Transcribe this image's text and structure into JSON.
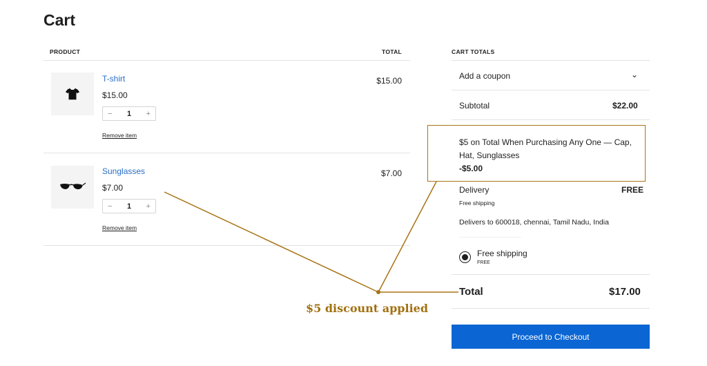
{
  "page": {
    "title": "Cart"
  },
  "table": {
    "col_product": "PRODUCT",
    "col_total": "TOTAL"
  },
  "items": [
    {
      "name": "T-shirt",
      "price": "$15.00",
      "qty": "1",
      "remove": "Remove item",
      "total": "$15.00",
      "icon": "tshirt-icon"
    },
    {
      "name": "Sunglasses",
      "price": "$7.00",
      "qty": "1",
      "remove": "Remove item",
      "total": "$7.00",
      "icon": "sunglasses-icon"
    }
  ],
  "qty_controls": {
    "minus": "−",
    "plus": "+"
  },
  "totals": {
    "heading": "CART TOTALS",
    "coupon_label": "Add a coupon",
    "coupon_chevron": "⌄",
    "subtotal_label": "Subtotal",
    "subtotal_value": "$22.00",
    "discount_line1": "$5 on Total When Purchasing Any One — Cap,",
    "discount_line2": "Hat, Sunglasses",
    "discount_value": "-$5.00",
    "delivery_label": "Delivery",
    "delivery_value": "FREE",
    "delivery_sub": "Free shipping",
    "delivers_to": "Delivers to 600018, chennai, Tamil Nadu, India",
    "shipping_option": "Free shipping",
    "shipping_option_price": "FREE",
    "total_label": "Total",
    "total_value": "$17.00",
    "checkout_label": "Proceed to Checkout"
  },
  "annotation": {
    "text": "$5 discount applied",
    "color": "#a2700f"
  },
  "colors": {
    "link": "#2b6fc6",
    "button": "#0b66d3",
    "annotation": "#a87315"
  }
}
